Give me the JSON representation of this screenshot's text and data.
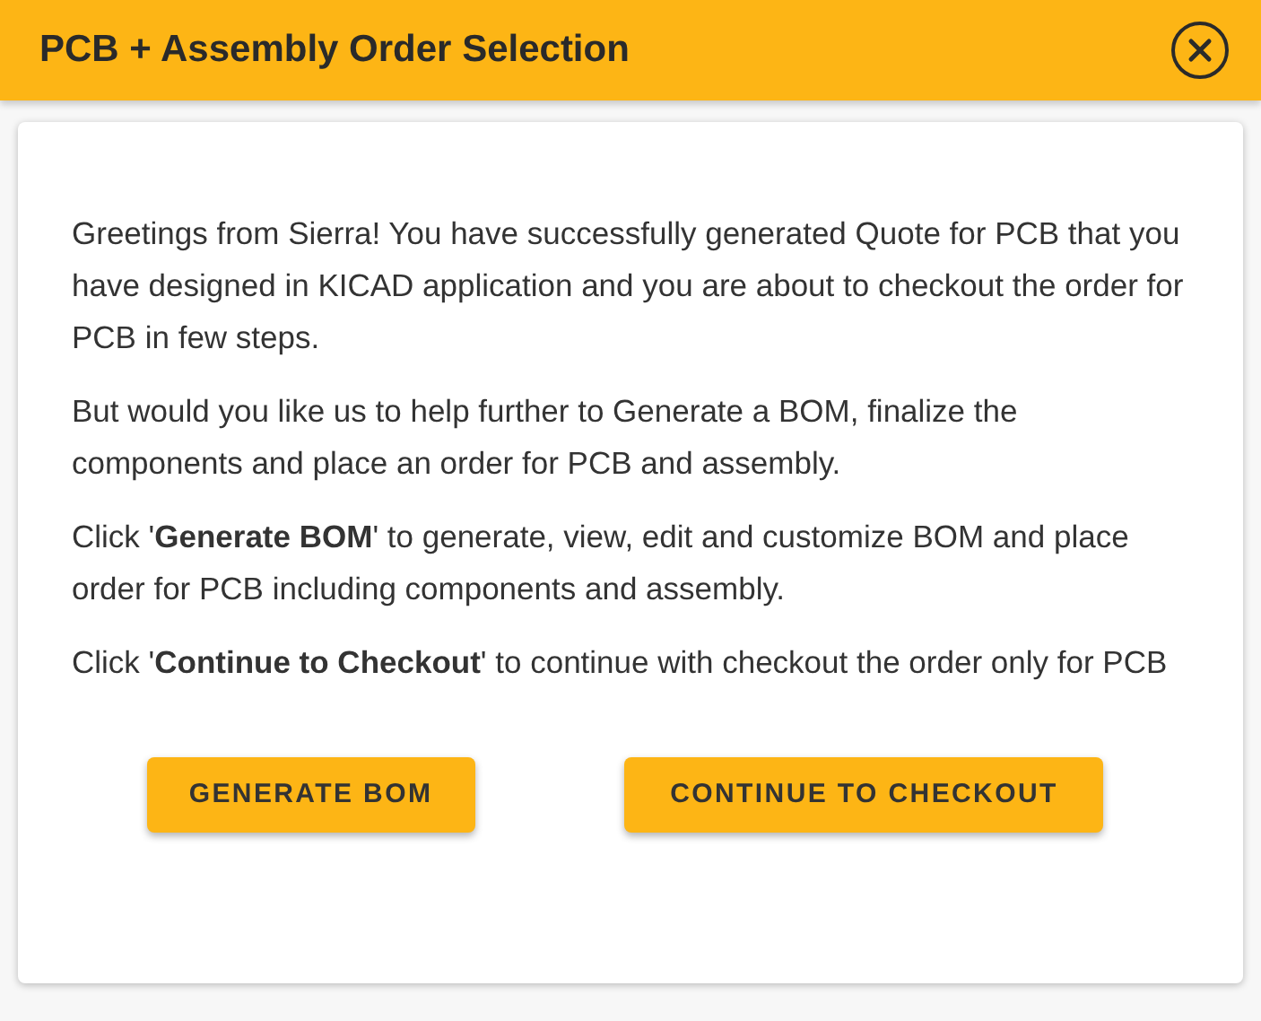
{
  "dialog": {
    "title": "PCB + Assembly Order Selection",
    "paragraphs": [
      "Greetings from Sierra! You have successfully generated Quote for PCB that you have designed in KICAD application and you are about to checkout the order for PCB in few steps.",
      "But would you like us to help further to Generate a BOM, finalize the components and place an order for PCB and assembly.",
      "Click '**Generate BOM**' to generate, view, edit and customize BOM and place order for PCB including components and assembly.",
      "Click '**Continue to Checkout**' to continue with checkout the order only for PCB"
    ],
    "buttons": [
      "GENERATE BOM",
      "CONTINUE TO CHECKOUT"
    ]
  }
}
